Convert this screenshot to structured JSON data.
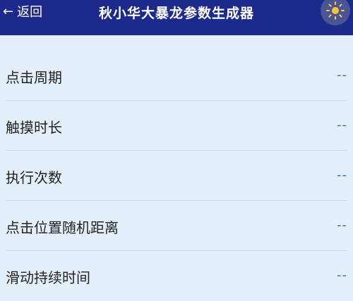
{
  "header": {
    "back_label": "返回",
    "back_arrow": "←",
    "title": "秋小华大暴龙参数生成器",
    "theme_icon": "sun-icon",
    "bg_color": "#1c2a8c"
  },
  "params": [
    {
      "label": "点击周期",
      "value": "--"
    },
    {
      "label": "触摸时长",
      "value": "--"
    },
    {
      "label": "执行次数",
      "value": "--"
    },
    {
      "label": "点击位置随机距离",
      "value": "--"
    },
    {
      "label": "滑动持续时间",
      "value": "--"
    }
  ],
  "colors": {
    "background": "#e3f0fc",
    "value_accent": "#2a78c8"
  }
}
